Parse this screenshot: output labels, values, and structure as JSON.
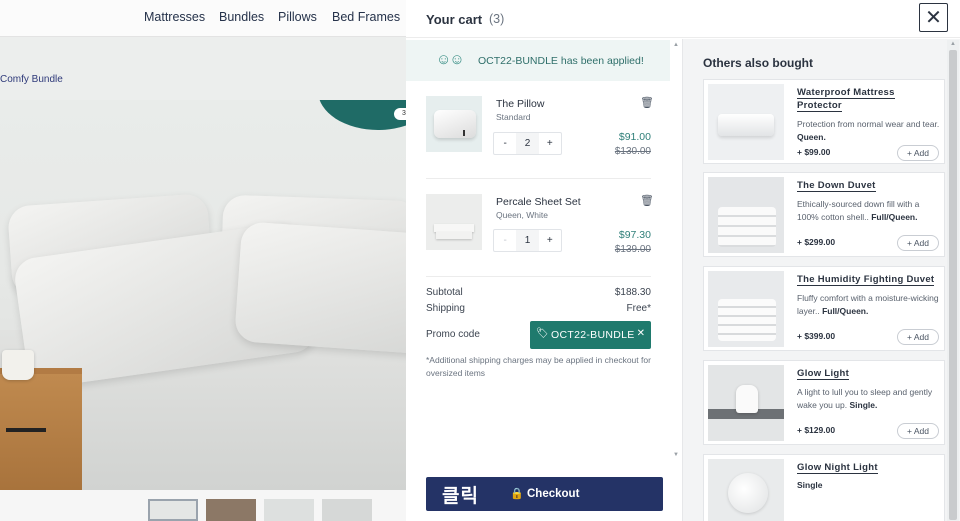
{
  "nav": {
    "items": [
      "Mattresses",
      "Bundles",
      "Pillows",
      "Bed Frames"
    ]
  },
  "breadcrumb": "Comfy Bundle",
  "hero": {
    "badge": "3"
  },
  "cart": {
    "title": "Your cart",
    "count": "(3)",
    "promo_banner": "OCT22-BUNDLE has been applied!",
    "items": [
      {
        "name": "The Pillow",
        "variant": "Standard",
        "qty": "2",
        "minus": "-",
        "plus": "+",
        "price": "$91.00",
        "old_price": "$130.00"
      },
      {
        "name": "Percale Sheet Set",
        "variant": "Queen, White",
        "qty": "1",
        "minus": "-",
        "plus": "+",
        "price": "$97.30",
        "old_price": "$139.00"
      }
    ],
    "subtotal_label": "Subtotal",
    "subtotal_value": "$188.30",
    "shipping_label": "Shipping",
    "shipping_value": "Free*",
    "promo_label": "Promo code",
    "promo_code": "OCT22-BUNDLE",
    "disclaimer": "*Additional shipping charges may be applied in checkout for oversized items",
    "checkout_annotation": "클릭",
    "checkout_label": "Checkout"
  },
  "others": {
    "title": "Others also bought",
    "add_label": "+ Add",
    "products": [
      {
        "name": "Waterproof Mattress Protector",
        "desc": "Protection from normal wear and tear.",
        "size": "Queen.",
        "price": "+ $99.00"
      },
      {
        "name": "The Down Duvet",
        "desc": "Ethically-sourced down fill with a 100% cotton shell..",
        "size": "Full/Queen.",
        "price": "+ $299.00"
      },
      {
        "name": "The Humidity Fighting Duvet",
        "desc": "Fluffy comfort with a moisture-wicking layer..",
        "size": "Full/Queen.",
        "price": "+ $399.00"
      },
      {
        "name": "Glow Light",
        "desc": "A light to lull you to sleep and gently wake you up.",
        "size": "Single.",
        "price": "+ $129.00"
      },
      {
        "name": "Glow Night Light",
        "desc": "",
        "size": "Single",
        "price": ""
      }
    ]
  },
  "colors": {
    "accent_teal": "#1f7a6d",
    "checkout_navy": "#243366"
  }
}
